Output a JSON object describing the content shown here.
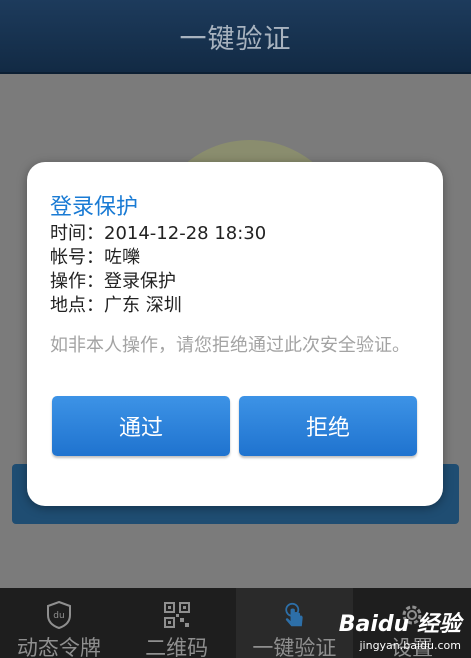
{
  "header": {
    "title": "一键验证"
  },
  "dialog": {
    "title": "登录保护",
    "lines": [
      "时间：2014-12-28 18:30",
      "帐号：咗嚛",
      "操作：登录保护",
      "地点：广东 深圳"
    ],
    "warning": "如非本人操作，请您拒绝通过此次安全验证。",
    "approve_label": "通过",
    "reject_label": "拒绝",
    "accent_color": "#1a7bd4"
  },
  "tabs": [
    {
      "label": "动态令牌",
      "icon": "shield-icon",
      "active": false
    },
    {
      "label": "二维码",
      "icon": "qr-code-icon",
      "active": false
    },
    {
      "label": "一键验证",
      "icon": "tap-hand-icon",
      "active": true
    },
    {
      "label": "设置",
      "icon": "gear-icon",
      "active": false
    }
  ],
  "watermark": {
    "logo": "Baidu 经验",
    "url": "jingyan.baidu.com"
  }
}
